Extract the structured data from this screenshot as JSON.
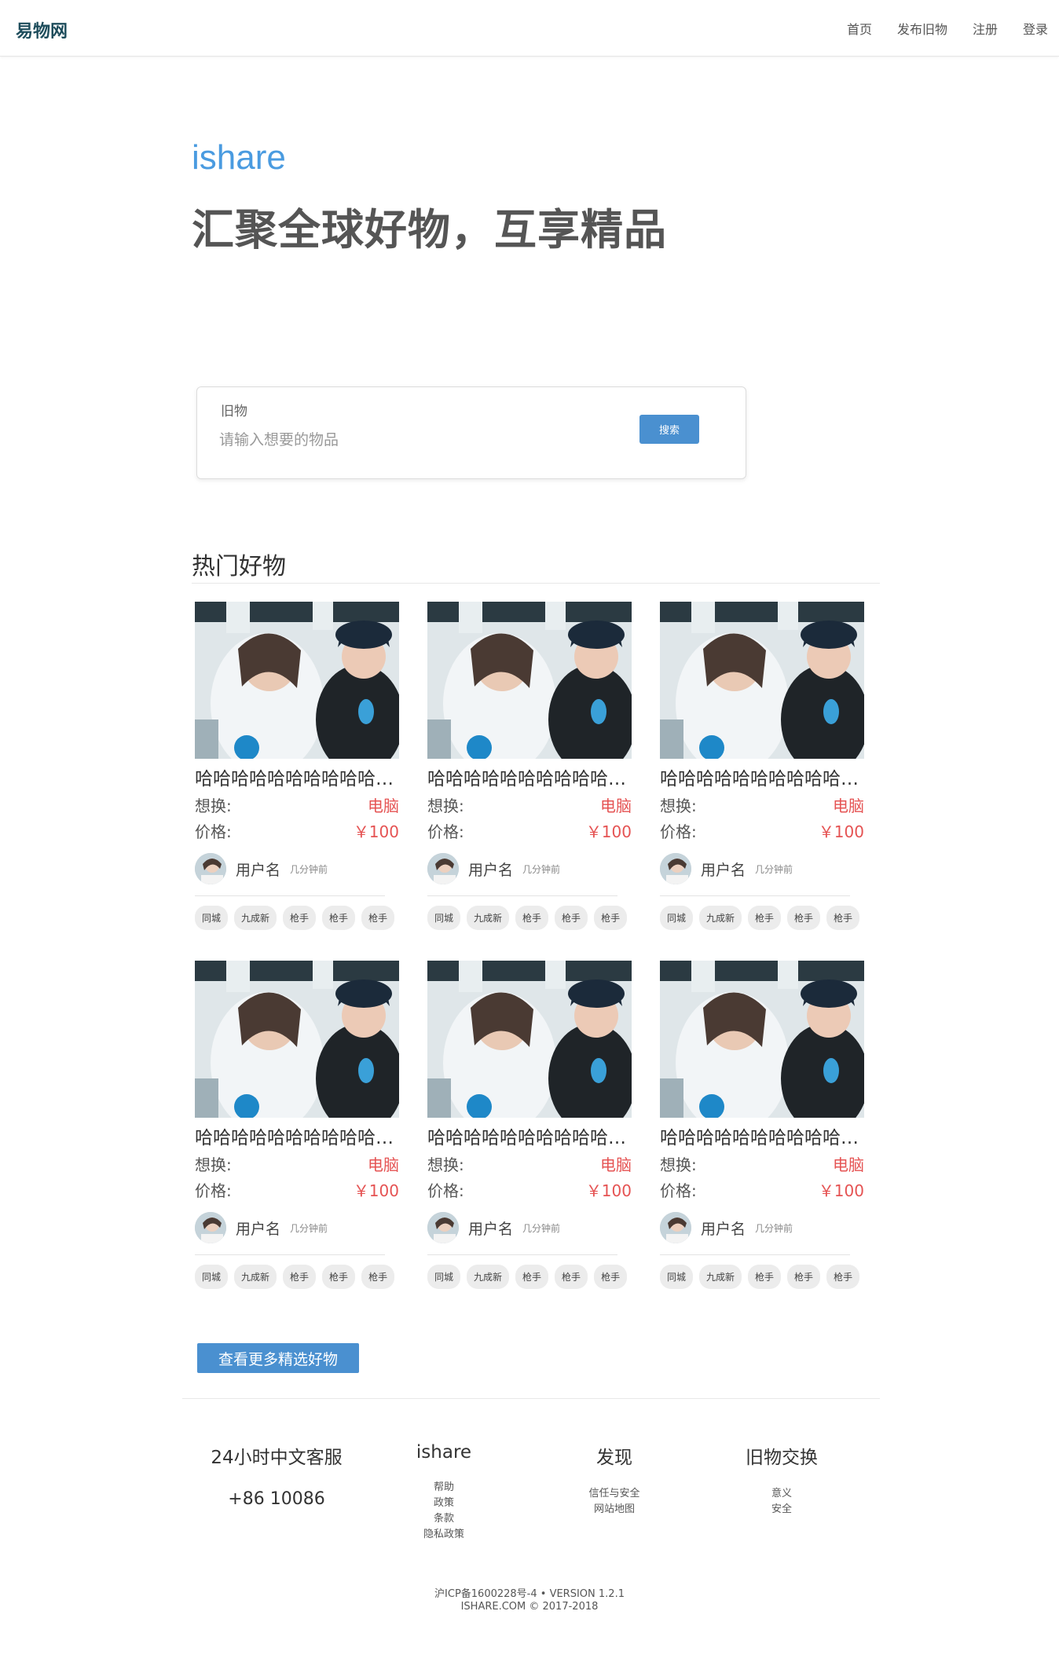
{
  "header": {
    "logo": "易物网",
    "nav": [
      "首页",
      "发布旧物",
      "注册",
      "登录"
    ]
  },
  "hero": {
    "brand": "ishare",
    "slogan": "汇聚全球好物，互享精品"
  },
  "search": {
    "label": "旧物",
    "placeholder": "请输入想要的物品",
    "button": "搜索"
  },
  "section": {
    "title": "热门好物",
    "more_button": "查看更多精选好物"
  },
  "products": [
    {
      "title": "哈哈哈哈哈哈哈哈哈哈哈哈",
      "want_label": "想换:",
      "want": "电脑",
      "price_label": "价格:",
      "price": "￥100",
      "user": "用户名",
      "time": "几分钟前",
      "tags": [
        "同城",
        "九成新",
        "枪手",
        "枪手",
        "枪手"
      ]
    },
    {
      "title": "哈哈哈哈哈哈哈哈哈哈哈哈",
      "want_label": "想换:",
      "want": "电脑",
      "price_label": "价格:",
      "price": "￥100",
      "user": "用户名",
      "time": "几分钟前",
      "tags": [
        "同城",
        "九成新",
        "枪手",
        "枪手",
        "枪手"
      ]
    },
    {
      "title": "哈哈哈哈哈哈哈哈哈哈哈哈",
      "want_label": "想换:",
      "want": "电脑",
      "price_label": "价格:",
      "price": "￥100",
      "user": "用户名",
      "time": "几分钟前",
      "tags": [
        "同城",
        "九成新",
        "枪手",
        "枪手",
        "枪手"
      ]
    },
    {
      "title": "哈哈哈哈哈哈哈哈哈哈哈哈",
      "want_label": "想换:",
      "want": "电脑",
      "price_label": "价格:",
      "price": "￥100",
      "user": "用户名",
      "time": "几分钟前",
      "tags": [
        "同城",
        "九成新",
        "枪手",
        "枪手",
        "枪手"
      ]
    },
    {
      "title": "哈哈哈哈哈哈哈哈哈哈哈哈",
      "want_label": "想换:",
      "want": "电脑",
      "price_label": "价格:",
      "price": "￥100",
      "user": "用户名",
      "time": "几分钟前",
      "tags": [
        "同城",
        "九成新",
        "枪手",
        "枪手",
        "枪手"
      ]
    },
    {
      "title": "哈哈哈哈哈哈哈哈哈哈哈哈",
      "want_label": "想换:",
      "want": "电脑",
      "price_label": "价格:",
      "price": "￥100",
      "user": "用户名",
      "time": "几分钟前",
      "tags": [
        "同城",
        "九成新",
        "枪手",
        "枪手",
        "枪手"
      ]
    }
  ],
  "footer": {
    "service": {
      "title": "24小时中文客服",
      "phone": "+86 10086"
    },
    "ishare": {
      "title": "ishare",
      "links": [
        "帮助",
        "政策",
        "条款",
        "隐私政策"
      ]
    },
    "discover": {
      "title": "发现",
      "links": [
        "信任与安全",
        "网站地图"
      ]
    },
    "exchange": {
      "title": "旧物交换",
      "links": [
        "意义",
        "安全"
      ]
    },
    "icp": "沪ICP备1600228号-4 • VERSION 1.2.1",
    "copyright": "ISHARE.COM © 2017-2018"
  },
  "colors": {
    "accent": "#4a90d0",
    "brand": "#4a9be0",
    "price": "#e55353",
    "logo": "#1e4d5c"
  }
}
